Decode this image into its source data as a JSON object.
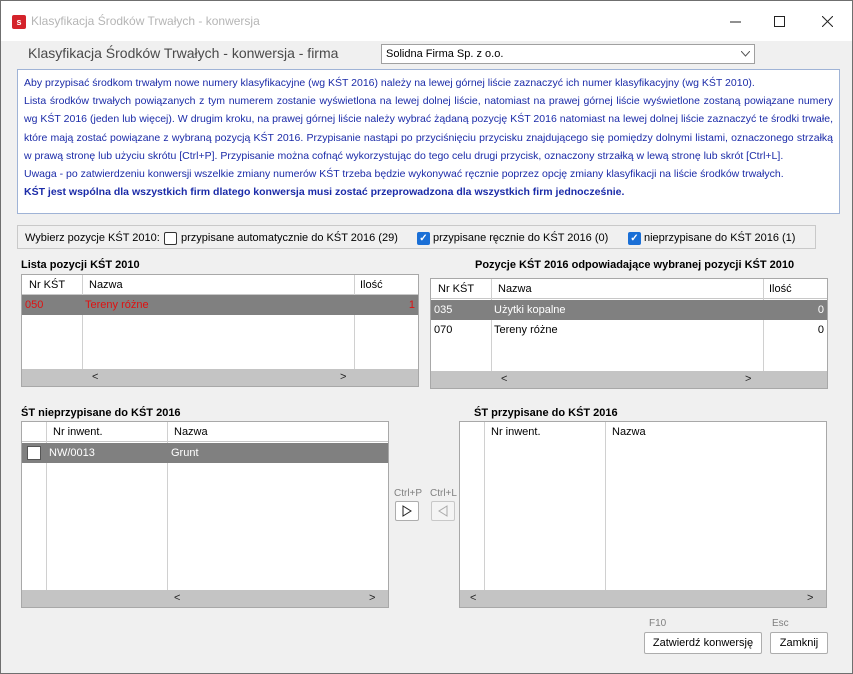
{
  "window": {
    "title": "Klasyfikacja Środków Trwałych - konwersja",
    "app_icon_label": "s"
  },
  "header": {
    "title": "Klasyfikacja Środków Trwałych - konwersja - firma",
    "firm_selected": "Solidna Firma Sp. z o.o."
  },
  "info": {
    "line1": "Aby przypisać środkom trwałym nowe numery klasyfikacyjne (wg KŚT 2016) należy na lewej górnej liście zaznaczyć ich numer klasyfikacyjny (wg KŚT 2010).",
    "line2": "Lista środków trwałych powiązanych z tym numerem zostanie wyświetlona na lewej dolnej liście, natomiast na prawej górnej liście wyświetlone zostaną powiązane numery wg KŚT 2016 (jeden lub więcej).  W drugim kroku, na prawej górnej liście należy wybrać żądaną pozycję KŚT 2016 natomiast na lewej dolnej liście zaznaczyć te środki trwałe, które mają zostać powiązane z wybraną pozycją KŚT 2016. Przypisanie nastąpi po przyciśnięciu przycisku znajdującego się pomiędzy dolnymi listami, oznaczonego strzałką w prawą stronę lub użyciu skrótu [Ctrl+P]. Przypisanie można cofnąć wykorzystując do tego celu drugi przycisk, oznaczony strzałką w lewą stronę lub skrót [Ctrl+L].",
    "line3": "Uwaga - po zatwierdzeniu konwersji wszelkie zmiany numerów KŚT trzeba będzie wykonywać ręcznie poprzez opcję zmiany klasyfikacji na liście środków trwałych.",
    "bold": "KŚT jest wspólna dla wszystkich firm dlatego konwersja musi zostać przeprowadzona dla wszystkich firm jednocześnie."
  },
  "filter": {
    "label": "Wybierz pozycje KŚT 2010:",
    "auto": "przypisane automatycznie do KŚT 2016 (29)",
    "manual": "przypisane ręcznie do KŚT 2016 (0)",
    "unassigned": "nieprzypisane do KŚT 2016 (1)"
  },
  "list2010": {
    "title": "Lista pozycji KŚT 2010",
    "headers": [
      "Nr KŚT",
      "Nazwa",
      "Ilość"
    ],
    "rows": [
      {
        "nr": "050",
        "nazwa": "Tereny różne",
        "ilosc": "1"
      }
    ]
  },
  "list2016": {
    "title": "Pozycje KŚT 2016 odpowiadające wybranej pozycji KŚT 2010",
    "headers": [
      "Nr KŚT",
      "Nazwa",
      "Ilość"
    ],
    "rows": [
      {
        "nr": "035",
        "nazwa": "Użytki kopalne",
        "ilosc": "0"
      },
      {
        "nr": "070",
        "nazwa": "Tereny różne",
        "ilosc": "0"
      }
    ]
  },
  "unassigned": {
    "title": "ŚT nieprzypisane do KŚT 2016",
    "headers": [
      "Nr inwent.",
      "Nazwa"
    ],
    "rows": [
      {
        "nr": "NW/0013",
        "nazwa": "Grunt"
      }
    ]
  },
  "assigned": {
    "title": "ŚT przypisane do KŚT 2016",
    "headers": [
      "Nr inwent.",
      "Nazwa"
    ]
  },
  "transfer": {
    "right_shortcut": "Ctrl+P",
    "left_shortcut": "Ctrl+L"
  },
  "footer": {
    "confirm_shortcut": "F10",
    "confirm_label": "Zatwierdź konwersję",
    "close_shortcut": "Esc",
    "close_label": "Zamknij"
  },
  "scroll": {
    "left": "<",
    "right": ">"
  },
  "colors": {
    "highlight_text": "#e01010",
    "selected_row": "#808080",
    "info_text": "#1b2ba8",
    "checkbox_on": "#1a6fd6"
  }
}
